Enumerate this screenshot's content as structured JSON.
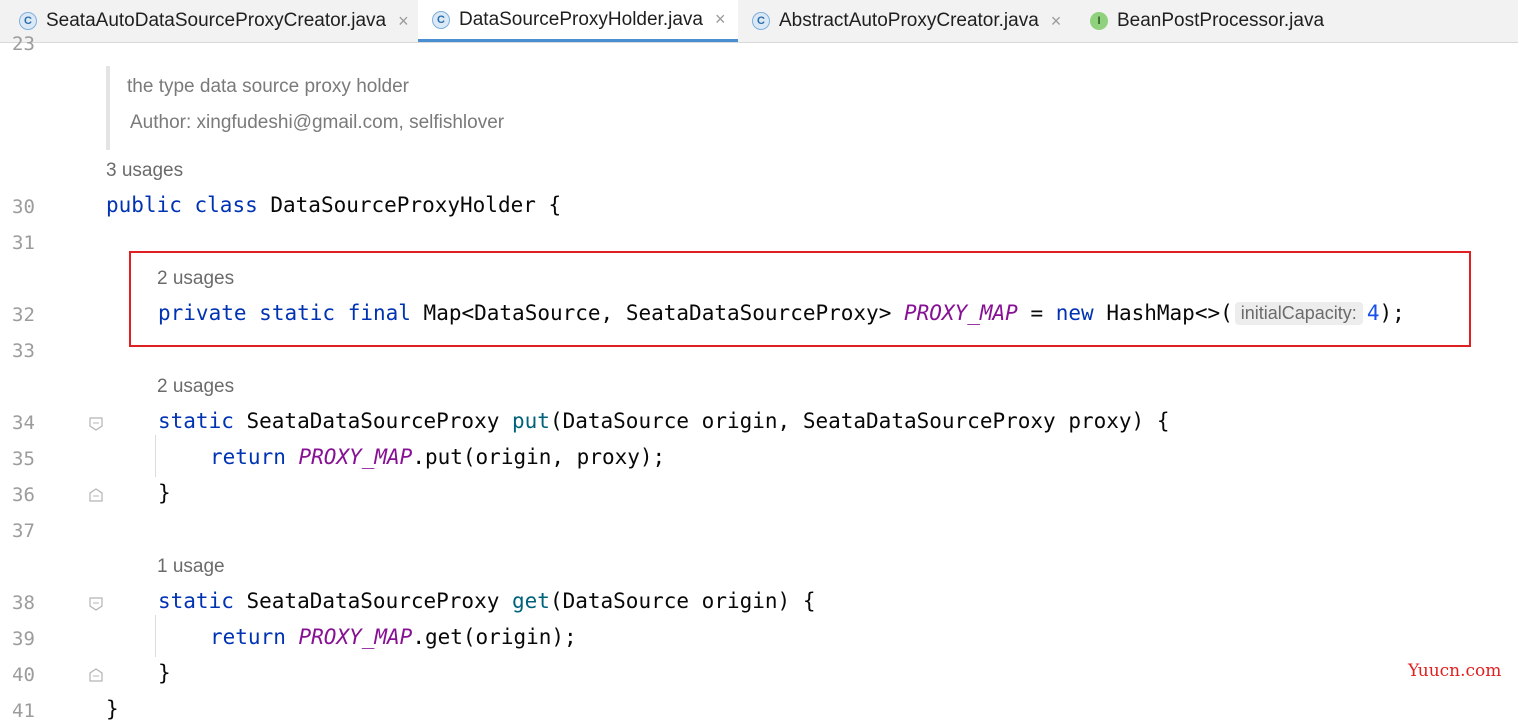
{
  "tabs": [
    {
      "label": "SeataAutoDataSourceProxyCreator.java",
      "icon": "C",
      "kind": "class"
    },
    {
      "label": "DataSourceProxyHolder.java",
      "icon": "C",
      "kind": "class",
      "active": true
    },
    {
      "label": "AbstractAutoProxyCreator.java",
      "icon": "C",
      "kind": "class"
    },
    {
      "label": "BeanPostProcessor.java",
      "icon": "I",
      "kind": "interface"
    }
  ],
  "close_glyph": "×",
  "line_numbers": {
    "l23": "23",
    "l30": "30",
    "l31": "31",
    "l32": "32",
    "l33": "33",
    "l34": "34",
    "l35": "35",
    "l36": "36",
    "l37": "37",
    "l38": "38",
    "l39": "39",
    "l40": "40",
    "l41": "41"
  },
  "doc": {
    "line1": "the type data source proxy holder",
    "line2": "Author: xingfudeshi@gmail.com, selfishlover"
  },
  "usages": {
    "class": "3 usages",
    "field": "2 usages",
    "put": "2 usages",
    "get": "1 usage"
  },
  "code": {
    "public": "public",
    "class": "class",
    "class_name": " DataSourceProxyHolder {",
    "private": "private",
    "static": "static",
    "final": "final",
    "field_type": " Map<DataSource, SeataDataSourceProxy> ",
    "proxy_map": "PROXY_MAP",
    "assign": " = ",
    "new": "new",
    "hashmap": " HashMap<>(",
    "hint": "initialCapacity:",
    "cap": "4",
    "end": ");",
    "put_ret": " SeataDataSourceProxy ",
    "put": "put",
    "put_params": "(DataSource origin, SeataDataSourceProxy proxy) {",
    "return": "return",
    "put_call": ".put(origin, proxy);",
    "close_brace": "}",
    "get_ret": " SeataDataSourceProxy ",
    "get": "get",
    "get_params": "(DataSource origin) {",
    "get_call": ".get(origin);"
  },
  "watermark": "Yuucn.com",
  "colors": {
    "keyword": "#0033b3",
    "constant": "#871094",
    "method": "#00627a",
    "number": "#1750eb",
    "highlight_box": "#e02020"
  }
}
